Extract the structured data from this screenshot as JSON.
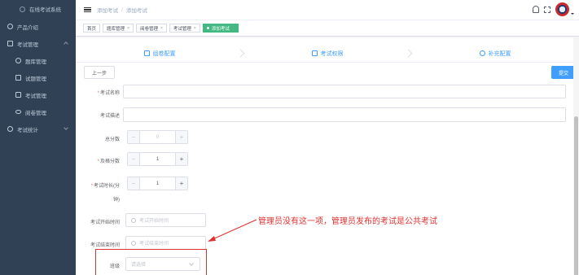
{
  "sidebar": {
    "logo_text": "在线考试系统",
    "items": [
      {
        "label": "产品介绍"
      },
      {
        "label": "考试管理"
      },
      {
        "label": "题库管理"
      },
      {
        "label": "试题管理"
      },
      {
        "label": "考试管理"
      },
      {
        "label": "阅卷管理"
      },
      {
        "label": "考试统计"
      }
    ]
  },
  "header": {
    "breadcrumb": [
      "添加考试",
      "添加考试"
    ]
  },
  "tags": [
    {
      "label": "首页"
    },
    {
      "label": "题库管理"
    },
    {
      "label": "阅卷管理"
    },
    {
      "label": "考试管理"
    },
    {
      "label": "添加考试"
    }
  ],
  "steps": [
    {
      "label": "组卷配置",
      "icon": "edit-icon"
    },
    {
      "label": "考试权限",
      "icon": "lock-icon"
    },
    {
      "label": "补充配置",
      "icon": "gear-icon"
    }
  ],
  "buttons": {
    "prev": "上一步",
    "submit": "提交"
  },
  "form": {
    "name_label": "考试名称",
    "desc_label": "考试描述",
    "total_label": "总分数",
    "total_value": "0",
    "pass_label": "及格分数",
    "pass_value": "1",
    "duration_label": "考试时长(分",
    "duration_label_2": "钟)",
    "duration_value": "1",
    "start_label": "考试开始时间",
    "start_placeholder": "考试开始时间",
    "end_label": "考试结束时间",
    "end_placeholder": "考试结束时间",
    "class_label": "班级",
    "class_placeholder": "请选择"
  },
  "annotation": {
    "text": "管理员没有这一项，管理员发布的考试是公共考试",
    "color": "#e03131"
  },
  "colors": {
    "sidebar_bg": "#304156",
    "primary": "#409eff",
    "active_tag": "#42b983"
  }
}
